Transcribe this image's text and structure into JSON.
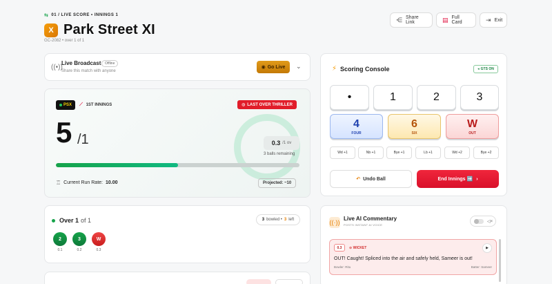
{
  "header": {
    "crumb": "01 / LIVE SCORE • INNINGS 1",
    "team_logo": "X",
    "team_name": "Park Street XI",
    "meta": "GC-2082 • over 1 of 1",
    "actions": {
      "share": "Share Link",
      "card": "Full Card",
      "exit": "Exit"
    }
  },
  "broadcast": {
    "title": "Live Broadcast",
    "status": "Offline",
    "subtitle": "Share this match with anyone",
    "go_live": "Go Live"
  },
  "score": {
    "team_badge": "PSX",
    "innings": "1ST INNINGS",
    "thriller": "LAST OVER THRILLER",
    "runs": "5",
    "wickets": "/1",
    "overs_value": "0.3",
    "overs_unit": "/1 ov",
    "balls_remaining": "3 balls remaining",
    "progress_fraction": 0.5,
    "crr_label": "Current Run Rate:",
    "crr_value": "10.00",
    "projected": "Projected: ~10"
  },
  "over": {
    "title": "Over 1",
    "of": "of 1",
    "bowled_count": "3",
    "bowled_label": "bowled •",
    "left_count": "3",
    "left_label": "left",
    "balls": [
      {
        "value": "2",
        "label": "0.1",
        "kind": "run"
      },
      {
        "value": "3",
        "label": "0.2",
        "kind": "run"
      },
      {
        "value": "W",
        "label": "0.3",
        "kind": "wicket"
      }
    ]
  },
  "console": {
    "title": "Scoring Console",
    "gts": "GTS ON",
    "runs": [
      "•",
      "1",
      "2",
      "3"
    ],
    "four": {
      "label": "4",
      "sub": "FOUR"
    },
    "six": {
      "label": "6",
      "sub": "SIX"
    },
    "wicket": {
      "label": "W",
      "sub": "OUT"
    },
    "extras": [
      "Wd +1",
      "Nb +1",
      "Bye +1",
      "Lb +1",
      "Wd +2",
      "Bye +2"
    ],
    "undo": "Undo Ball",
    "end_innings": "End Innings ➡️"
  },
  "commentary": {
    "title": "Live AI Commentary",
    "subtitle": "POSTS INSTANT AI VOICE",
    "items": [
      {
        "over": "0.3",
        "tag": "WICKET",
        "text": "OUT! Caught! Spliced into the air and safely held, Sameer is out!",
        "bowler": "Bowler: Ritu",
        "batter": "Batter: Sameer"
      }
    ]
  },
  "colors": {
    "accent_green": "#16a34a",
    "accent_red": "#e11d2a",
    "accent_orange": "#e67e00"
  }
}
